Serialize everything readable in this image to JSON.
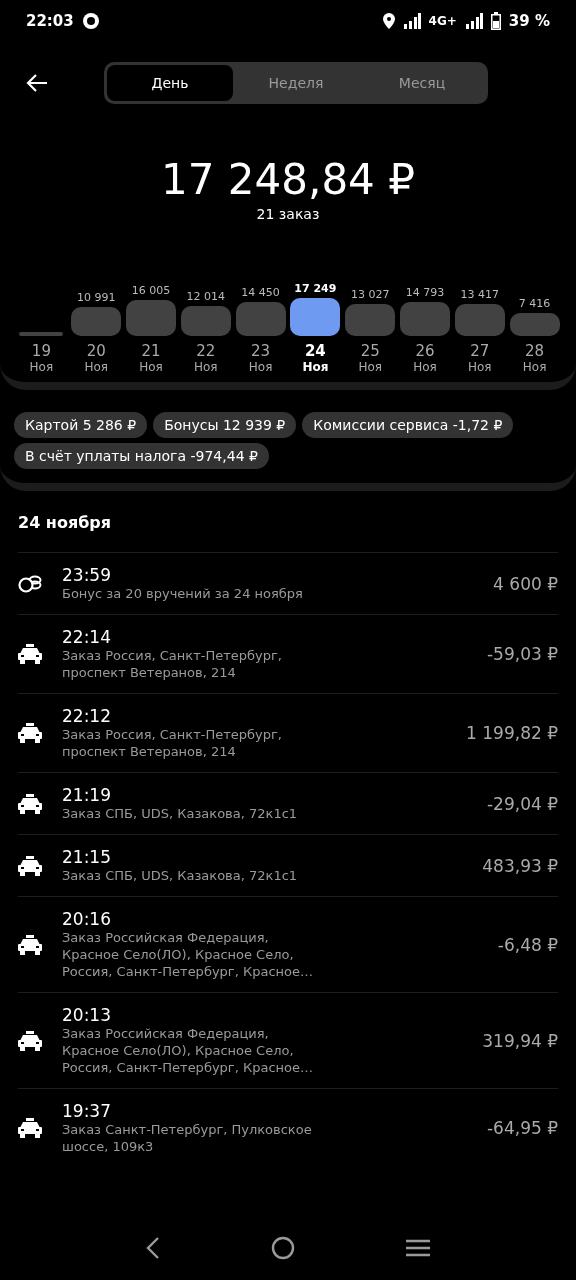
{
  "status_bar": {
    "time": "22:03",
    "network": "4G+",
    "battery": "39 %"
  },
  "tabs": [
    {
      "label": "День",
      "selected": true
    },
    {
      "label": "Неделя",
      "selected": false
    },
    {
      "label": "Месяц",
      "selected": false
    }
  ],
  "total": {
    "amount": "17 248,84 ₽",
    "orders": "21 заказ"
  },
  "days": [
    {
      "day": "19",
      "month": "Ноя",
      "selected": false
    },
    {
      "amount": "10 991",
      "day": "20",
      "month": "Ноя",
      "selected": false
    },
    {
      "amount": "16 005",
      "day": "21",
      "month": "Ноя",
      "selected": false
    },
    {
      "amount": "12 014",
      "day": "22",
      "month": "Ноя",
      "selected": false
    },
    {
      "amount": "14 450",
      "day": "23",
      "month": "Ноя",
      "selected": false
    },
    {
      "amount": "17 249",
      "day": "24",
      "month": "Ноя",
      "selected": true
    },
    {
      "amount": "13 027",
      "day": "25",
      "month": "Ноя",
      "selected": false
    },
    {
      "amount": "14 793",
      "day": "26",
      "month": "Ноя",
      "selected": false
    },
    {
      "amount": "13 417",
      "day": "27",
      "month": "Ноя",
      "selected": false
    },
    {
      "amount": "7 416",
      "day": "28",
      "month": "Ноя",
      "selected": false
    }
  ],
  "chips": [
    "Картой 5 286 ₽",
    "Бонусы 12 939 ₽",
    "Комиссии сервиса -1,72 ₽",
    "В счёт уплаты налога -974,44 ₽"
  ],
  "list_title": "24 ноября",
  "transactions": [
    {
      "kind": "bonus",
      "time": "23:59",
      "description": "Бонус за 20 вручений за 24 ноября",
      "amount": "4 600 ₽"
    },
    {
      "kind": "order",
      "time": "22:14",
      "description": "Заказ Россия, Санкт-Петербург, проспект Ветеранов, 214",
      "amount": "-59,03 ₽"
    },
    {
      "kind": "order",
      "time": "22:12",
      "description": "Заказ Россия, Санкт-Петербург, проспект Ветеранов, 214",
      "amount": "1 199,82 ₽"
    },
    {
      "kind": "order",
      "time": "21:19",
      "description": "Заказ СПБ, UDS, Казакова, 72к1с1",
      "amount": "-29,04 ₽"
    },
    {
      "kind": "order",
      "time": "21:15",
      "description": "Заказ СПБ, UDS, Казакова, 72к1с1",
      "amount": "483,93 ₽"
    },
    {
      "kind": "order",
      "time": "20:16",
      "description": "Заказ Российская Федерация, Красное Село(ЛО), Красное Село, Россия, Санкт-Петербург, Красное…",
      "amount": "-6,48 ₽"
    },
    {
      "kind": "order",
      "time": "20:13",
      "description": "Заказ Российская Федерация, Красное Село(ЛО), Красное Село, Россия, Санкт-Петербург, Красное…",
      "amount": "319,94 ₽"
    },
    {
      "kind": "order",
      "time": "19:37",
      "description": "Заказ Санкт-Петербург, Пулковское шоссе, 109к3",
      "amount": "-64,95 ₽"
    }
  ]
}
